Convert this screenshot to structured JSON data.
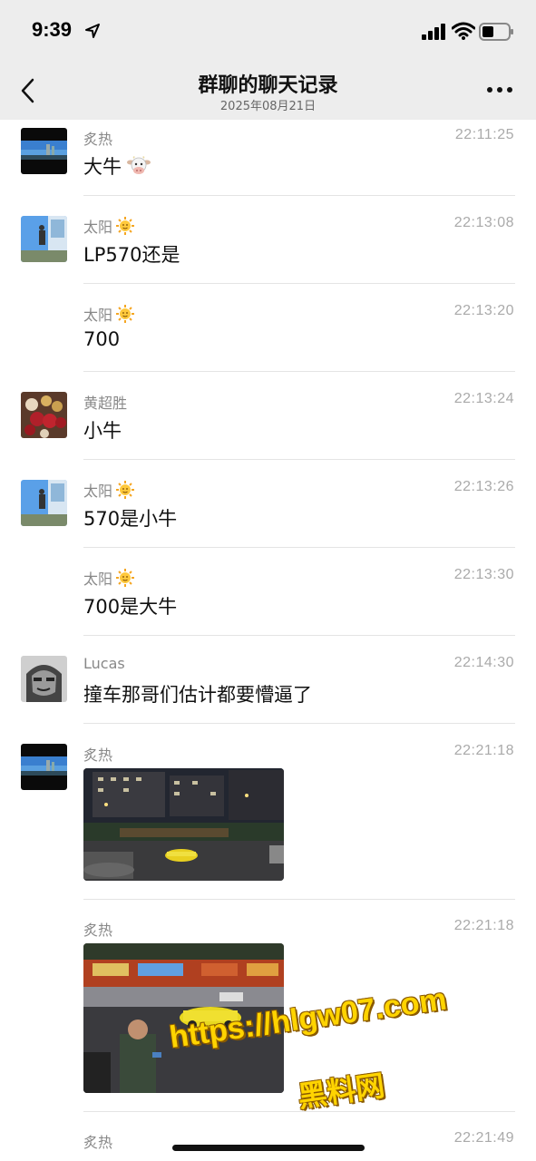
{
  "status_bar": {
    "time": "9:39"
  },
  "nav": {
    "title": "群聊的聊天记录",
    "subtitle": "2025年08月21日"
  },
  "messages": [
    {
      "sender": "炙热",
      "time": "22:11:25",
      "text": "大牛",
      "emoji": "cow-face"
    },
    {
      "sender": "太阳",
      "time": "22:13:08",
      "text": "LP570还是",
      "emoji_after_name": "sun-face"
    },
    {
      "sender": "太阳",
      "time": "22:13:20",
      "text": "700",
      "emoji_after_name": "sun-face"
    },
    {
      "sender": "黄超胜",
      "time": "22:13:24",
      "text": "小牛"
    },
    {
      "sender": "太阳",
      "time": "22:13:26",
      "text": "570是小牛",
      "emoji_after_name": "sun-face"
    },
    {
      "sender": "太阳",
      "time": "22:13:30",
      "text": "700是大牛",
      "emoji_after_name": "sun-face"
    },
    {
      "sender": "Lucas",
      "time": "22:14:30",
      "text": "撞车那哥们估计都要懵逼了"
    },
    {
      "sender": "炙热",
      "time": "22:21:18",
      "image": "night street with yellow sports car"
    },
    {
      "sender": "炙热",
      "time": "22:21:18",
      "image": "crowd around yellow sports car"
    },
    {
      "sender": "炙热",
      "time": "22:21:49",
      "text": ""
    }
  ],
  "watermark": {
    "url": "https://hlgw07.com",
    "name": "黑料网"
  },
  "colors": {
    "header_bg": "#ededed",
    "divider": "#e4e4e4",
    "sender_text": "#888888",
    "time_text": "#aaaaaa"
  }
}
